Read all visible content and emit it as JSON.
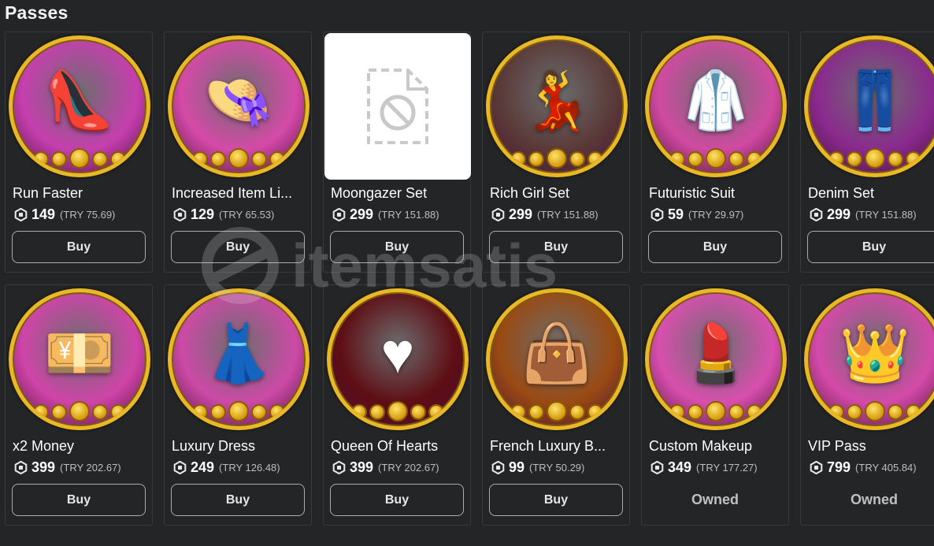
{
  "section": {
    "title": "Passes"
  },
  "currency_icon": "robux-icon",
  "watermark": {
    "text": "itemsatis"
  },
  "colors": {
    "background": "#232527",
    "card_border": "#393b3d",
    "badge_ring": "#e9b824",
    "button_border": "#a9abad"
  },
  "cards": [
    {
      "name": "Run Faster",
      "price": "149",
      "local": "(TRY 75.69)",
      "action": "Buy",
      "owned": false,
      "art": "shoe-icon",
      "glyph": "👠",
      "bg": "#c63fae"
    },
    {
      "name": "Increased Item Li...",
      "price": "129",
      "local": "(TRY 65.53)",
      "action": "Buy",
      "owned": false,
      "art": "hat-shirt-icon",
      "glyph": "👒",
      "bg": "#d54aa8"
    },
    {
      "name": "Moongazer Set",
      "price": "299",
      "local": "(TRY 151.88)",
      "action": "Buy",
      "owned": false,
      "art": "image-unavailable-icon",
      "glyph": "",
      "bg": "#ffffff",
      "placeholder": true
    },
    {
      "name": "Rich Girl Set",
      "price": "299",
      "local": "(TRY 151.88)",
      "action": "Buy",
      "owned": false,
      "art": "avatar-outfit-icon",
      "glyph": "💃",
      "bg": "#5a3a38"
    },
    {
      "name": "Futuristic Suit",
      "price": "59",
      "local": "(TRY 29.97)",
      "action": "Buy",
      "owned": false,
      "art": "suit-icon",
      "glyph": "🥼",
      "bg": "#d14aa2"
    },
    {
      "name": "Denim Set",
      "price": "299",
      "local": "(TRY 151.88)",
      "action": "Buy",
      "owned": false,
      "art": "denim-outfit-icon",
      "glyph": "👖",
      "bg": "#8a2a8e"
    },
    {
      "name": "x2 Money",
      "price": "399",
      "local": "(TRY 202.67)",
      "action": "Buy",
      "owned": false,
      "art": "money-icon",
      "glyph": "💴",
      "bg": "#cf44a8"
    },
    {
      "name": "Luxury Dress",
      "price": "249",
      "local": "(TRY 126.48)",
      "action": "Buy",
      "owned": false,
      "art": "dress-icon",
      "glyph": "👗",
      "bg": "#cc4aa6"
    },
    {
      "name": "Queen Of Hearts",
      "price": "399",
      "local": "(TRY 202.67)",
      "action": "Buy",
      "owned": false,
      "art": "heart-avatar-icon",
      "glyph": "♥",
      "bg": "#5e0e14"
    },
    {
      "name": "French Luxury B...",
      "price": "99",
      "local": "(TRY 50.29)",
      "action": "Buy",
      "owned": false,
      "art": "handbag-icon",
      "glyph": "👜",
      "bg": "#9a4a12"
    },
    {
      "name": "Custom Makeup",
      "price": "349",
      "local": "(TRY 177.27)",
      "action": "Owned",
      "owned": true,
      "art": "makeup-icon",
      "glyph": "💄",
      "bg": "#d84fae"
    },
    {
      "name": "VIP Pass",
      "price": "799",
      "local": "(TRY 405.84)",
      "action": "Owned",
      "owned": true,
      "art": "vip-crown-icon",
      "glyph": "👑",
      "bg": "#d44aa8"
    }
  ]
}
